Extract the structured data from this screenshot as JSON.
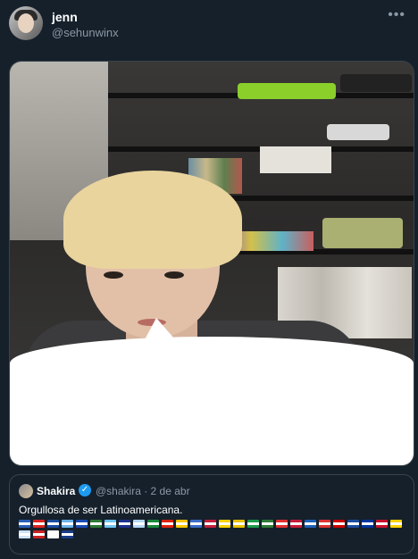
{
  "tweet": {
    "author_name": "jenn",
    "author_handle": "@sehunwinx",
    "more_icon": "more-icon"
  },
  "quoted": {
    "author_name": "Shakira",
    "meta": "@shakira · 2 de abr",
    "text": "Orgullosa de ser Latinoamericana.",
    "flags": [
      "#2b5fb8",
      "#d22",
      "#1b4da0",
      "#6bb3e8",
      "#1a4bb5",
      "#2f7a36",
      "#6ec5ef",
      "#1e2f8f",
      "#b5d6f2",
      "#1a8a3a",
      "#d21",
      "#f7c600",
      "#3a6cc8",
      "#c41e3a",
      "#f8d000",
      "#e8c200",
      "#1a9b4a",
      "#2f7a36",
      "#e03030",
      "#c41e3a",
      "#1b5fb8",
      "#d33",
      "#c00",
      "#1b4da0",
      "#0033a0",
      "#c8102e",
      "#ffd100",
      "#cfe3f7",
      "#cc2222",
      "#ffffff",
      "#1b3d8a"
    ]
  }
}
